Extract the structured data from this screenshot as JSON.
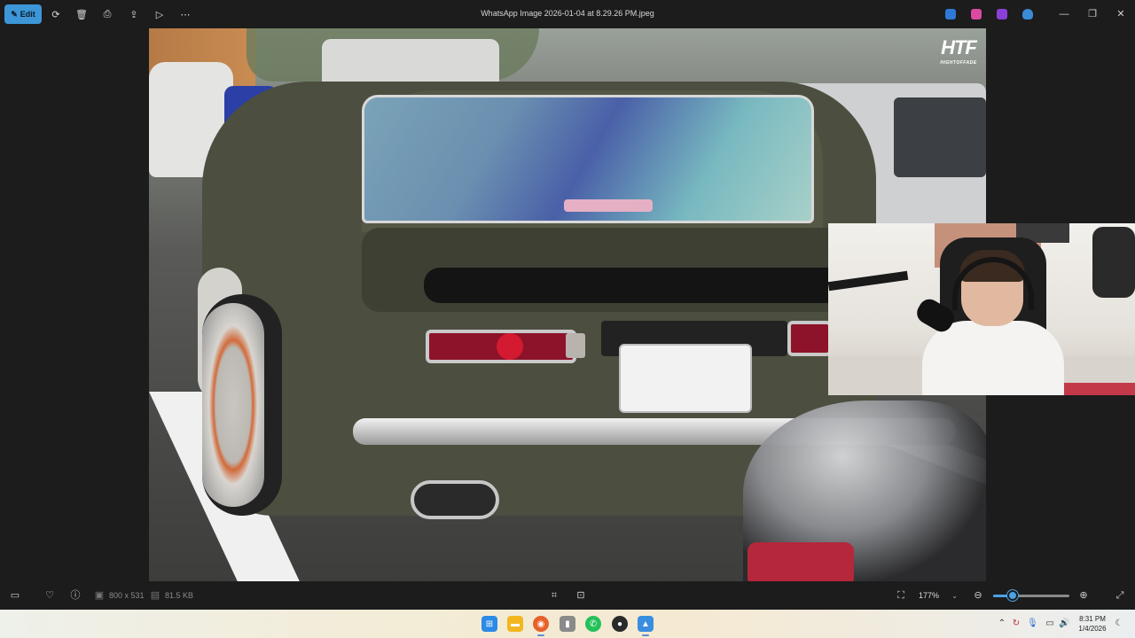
{
  "toolbar": {
    "edit_label": "Edit",
    "title": "WhatsApp Image 2026-01-04 at 8.29.26 PM.jpeg",
    "icons": [
      "edit-icon",
      "rotate-icon",
      "delete-icon",
      "print-icon",
      "share-icon",
      "slideshow-icon",
      "more-icon"
    ],
    "tray_icons": [
      "app-blue-icon",
      "app-pink-icon",
      "app-purple-icon",
      "cloud-off-icon"
    ],
    "window_controls": [
      "minimize-icon",
      "maximize-icon",
      "close-icon"
    ]
  },
  "image": {
    "watermark_main": "HTF",
    "watermark_sub": "HIGHTOFFADE"
  },
  "infobar": {
    "dimensions": "800 x 531",
    "file_size": "81.5 KB",
    "zoom_label": "177%",
    "zoom_level_fraction": 0.26,
    "icons": [
      "filmstrip-icon",
      "favorite-icon",
      "info-icon",
      "crop-icon",
      "ocr-icon",
      "fit-icon",
      "zoom-out-icon",
      "zoom-in-icon",
      "fullscreen-icon"
    ]
  },
  "taskbar": {
    "apps": [
      "start-icon",
      "file-explorer-icon",
      "firefox-icon",
      "microphone-app-icon",
      "whatsapp-icon",
      "obs-icon",
      "photos-icon"
    ],
    "time": "8:31 PM",
    "date": "1/4/2026"
  },
  "colors": {
    "accent": "#3c96d8",
    "toolbar_bg": "#1c1c1c"
  }
}
